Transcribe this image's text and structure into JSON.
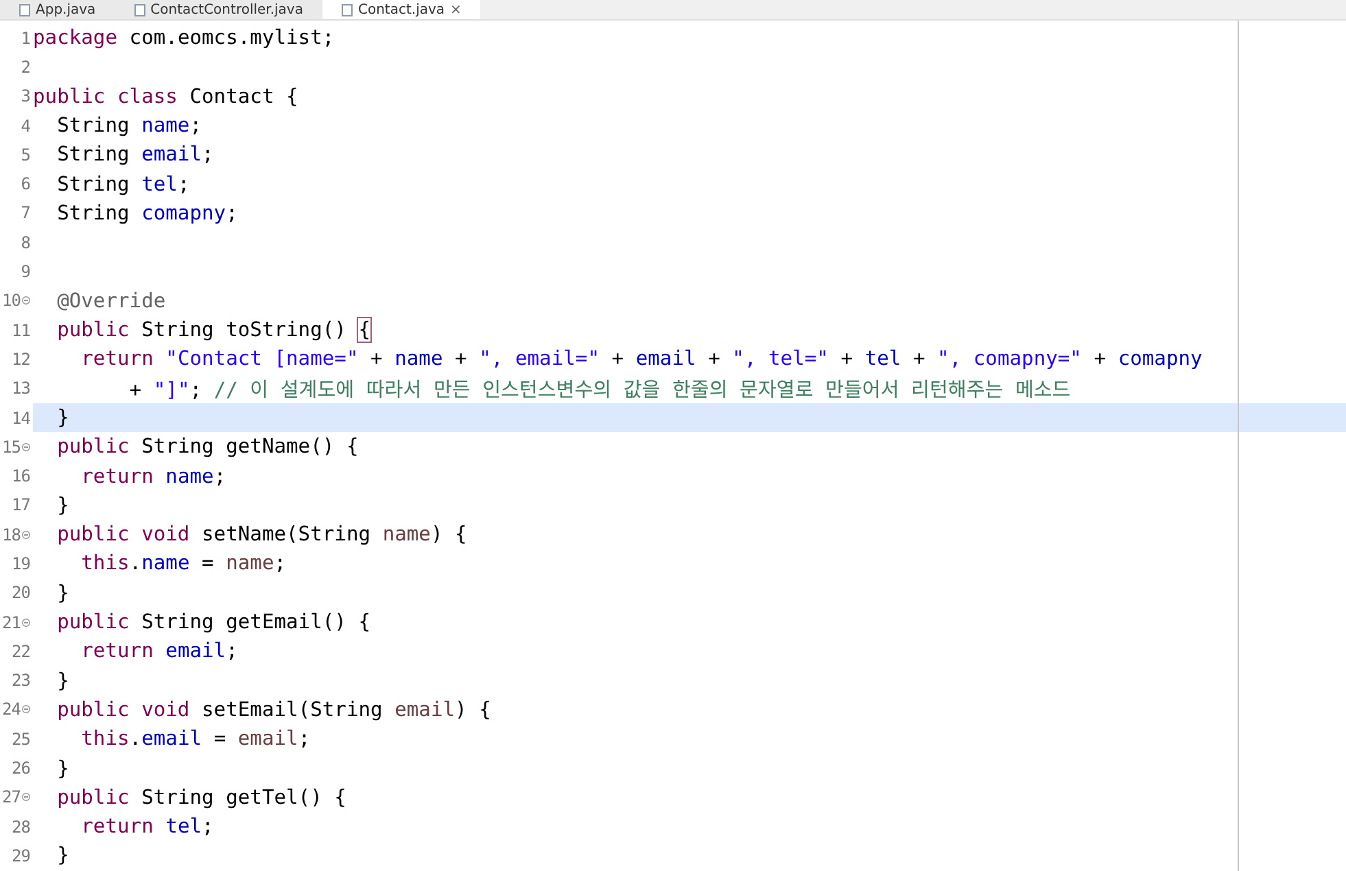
{
  "tabs": [
    {
      "label": "App.java",
      "selected": false
    },
    {
      "label": "ContactController.java",
      "selected": false
    },
    {
      "label": "Contact.java",
      "selected": true,
      "close": "×"
    }
  ],
  "editor": {
    "lines": [
      {
        "number": "1",
        "fold": false,
        "current": false,
        "tokens": [
          {
            "kind": "keyword",
            "text": "package"
          },
          {
            "kind": "plain",
            "text": " com.eomcs.mylist;"
          }
        ]
      },
      {
        "number": "2",
        "fold": false,
        "current": false
      },
      {
        "number": "3",
        "fold": false,
        "current": false,
        "tokens": [
          {
            "kind": "keyword",
            "text": "public class"
          },
          {
            "kind": "plain",
            "text": " Contact {"
          }
        ]
      },
      {
        "number": "4",
        "fold": false,
        "current": false,
        "tokens": [
          {
            "kind": "plain",
            "text": "  String "
          },
          {
            "kind": "field",
            "text": "name"
          },
          {
            "kind": "plain",
            "text": ";"
          }
        ]
      },
      {
        "number": "5",
        "fold": false,
        "current": false,
        "tokens": [
          {
            "kind": "plain",
            "text": "  String "
          },
          {
            "kind": "field",
            "text": "email"
          },
          {
            "kind": "plain",
            "text": ";"
          }
        ]
      },
      {
        "number": "6",
        "fold": false,
        "current": false,
        "tokens": [
          {
            "kind": "plain",
            "text": "  String "
          },
          {
            "kind": "field",
            "text": "tel"
          },
          {
            "kind": "plain",
            "text": ";"
          }
        ]
      },
      {
        "number": "7",
        "fold": false,
        "current": false,
        "tokens": [
          {
            "kind": "plain",
            "text": "  String "
          },
          {
            "kind": "field",
            "text": "comapny"
          },
          {
            "kind": "plain",
            "text": ";"
          }
        ]
      },
      {
        "number": "8",
        "fold": false,
        "current": false
      },
      {
        "number": "9",
        "fold": false,
        "current": false
      },
      {
        "number": "10",
        "fold": true,
        "current": false,
        "tokens": [
          {
            "kind": "annotation",
            "text": "  @Override"
          }
        ]
      },
      {
        "number": "11",
        "fold": false,
        "current": false,
        "tokens": [
          {
            "kind": "keyword",
            "text": "  public"
          },
          {
            "kind": "plain",
            "text": " String toString() "
          },
          {
            "kind": "bracket",
            "text": "{"
          }
        ]
      },
      {
        "number": "12",
        "fold": false,
        "current": false,
        "tokens": [
          {
            "kind": "keyword",
            "text": "    return "
          },
          {
            "kind": "string",
            "text": "\"Contact [name=\""
          },
          {
            "kind": "plain",
            "text": " + "
          },
          {
            "kind": "field",
            "text": "name"
          },
          {
            "kind": "plain",
            "text": " + "
          },
          {
            "kind": "string",
            "text": "\", email=\""
          },
          {
            "kind": "plain",
            "text": " + "
          },
          {
            "kind": "field",
            "text": "email"
          },
          {
            "kind": "plain",
            "text": " + "
          },
          {
            "kind": "string",
            "text": "\", tel=\""
          },
          {
            "kind": "plain",
            "text": " + "
          },
          {
            "kind": "field",
            "text": "tel"
          },
          {
            "kind": "plain",
            "text": " + "
          },
          {
            "kind": "string",
            "text": "\", comapny=\""
          },
          {
            "kind": "plain",
            "text": " + "
          },
          {
            "kind": "field",
            "text": "comapny"
          }
        ]
      },
      {
        "number": "13",
        "fold": false,
        "current": false,
        "tokens": [
          {
            "kind": "plain",
            "text": "        + "
          },
          {
            "kind": "string",
            "text": "\"]\""
          },
          {
            "kind": "plain",
            "text": "; "
          },
          {
            "kind": "comment",
            "text": "// 이 설계도에 따라서 만든 인스턴스변수의 값을 한줄의 문자열로 만들어서 리턴해주는 메소드"
          }
        ]
      },
      {
        "number": "14",
        "fold": false,
        "current": true,
        "tokens": [
          {
            "kind": "plain",
            "text": "  }"
          }
        ]
      },
      {
        "number": "15",
        "fold": true,
        "current": false,
        "tokens": [
          {
            "kind": "keyword",
            "text": "  public"
          },
          {
            "kind": "plain",
            "text": " String getName() {"
          }
        ]
      },
      {
        "number": "16",
        "fold": false,
        "current": false,
        "tokens": [
          {
            "kind": "keyword",
            "text": "    return "
          },
          {
            "kind": "field",
            "text": "name"
          },
          {
            "kind": "plain",
            "text": ";"
          }
        ]
      },
      {
        "number": "17",
        "fold": false,
        "current": false,
        "tokens": [
          {
            "kind": "plain",
            "text": "  }"
          }
        ]
      },
      {
        "number": "18",
        "fold": true,
        "current": false,
        "tokens": [
          {
            "kind": "keyword",
            "text": "  public void"
          },
          {
            "kind": "plain",
            "text": " setName(String "
          },
          {
            "kind": "param",
            "text": "name"
          },
          {
            "kind": "plain",
            "text": ") {"
          }
        ]
      },
      {
        "number": "19",
        "fold": false,
        "current": false,
        "tokens": [
          {
            "kind": "keyword",
            "text": "    this"
          },
          {
            "kind": "plain",
            "text": "."
          },
          {
            "kind": "field",
            "text": "name"
          },
          {
            "kind": "plain",
            "text": " = "
          },
          {
            "kind": "param",
            "text": "name"
          },
          {
            "kind": "plain",
            "text": ";"
          }
        ]
      },
      {
        "number": "20",
        "fold": false,
        "current": false,
        "tokens": [
          {
            "kind": "plain",
            "text": "  }"
          }
        ]
      },
      {
        "number": "21",
        "fold": true,
        "current": false,
        "tokens": [
          {
            "kind": "keyword",
            "text": "  public"
          },
          {
            "kind": "plain",
            "text": " String getEmail() {"
          }
        ]
      },
      {
        "number": "22",
        "fold": false,
        "current": false,
        "tokens": [
          {
            "kind": "keyword",
            "text": "    return "
          },
          {
            "kind": "field",
            "text": "email"
          },
          {
            "kind": "plain",
            "text": ";"
          }
        ]
      },
      {
        "number": "23",
        "fold": false,
        "current": false,
        "tokens": [
          {
            "kind": "plain",
            "text": "  }"
          }
        ]
      },
      {
        "number": "24",
        "fold": true,
        "current": false,
        "tokens": [
          {
            "kind": "keyword",
            "text": "  public void"
          },
          {
            "kind": "plain",
            "text": " setEmail(String "
          },
          {
            "kind": "param",
            "text": "email"
          },
          {
            "kind": "plain",
            "text": ") {"
          }
        ]
      },
      {
        "number": "25",
        "fold": false,
        "current": false,
        "tokens": [
          {
            "kind": "keyword",
            "text": "    this"
          },
          {
            "kind": "plain",
            "text": "."
          },
          {
            "kind": "field",
            "text": "email"
          },
          {
            "kind": "plain",
            "text": " = "
          },
          {
            "kind": "param",
            "text": "email"
          },
          {
            "kind": "plain",
            "text": ";"
          }
        ]
      },
      {
        "number": "26",
        "fold": false,
        "current": false,
        "tokens": [
          {
            "kind": "plain",
            "text": "  }"
          }
        ]
      },
      {
        "number": "27",
        "fold": true,
        "current": false,
        "tokens": [
          {
            "kind": "keyword",
            "text": "  public"
          },
          {
            "kind": "plain",
            "text": " String getTel() {"
          }
        ]
      },
      {
        "number": "28",
        "fold": false,
        "current": false,
        "tokens": [
          {
            "kind": "keyword",
            "text": "    return "
          },
          {
            "kind": "field",
            "text": "tel"
          },
          {
            "kind": "plain",
            "text": ";"
          }
        ]
      },
      {
        "number": "29",
        "fold": false,
        "current": false,
        "tokens": [
          {
            "kind": "plain",
            "text": "  }"
          }
        ]
      }
    ]
  }
}
